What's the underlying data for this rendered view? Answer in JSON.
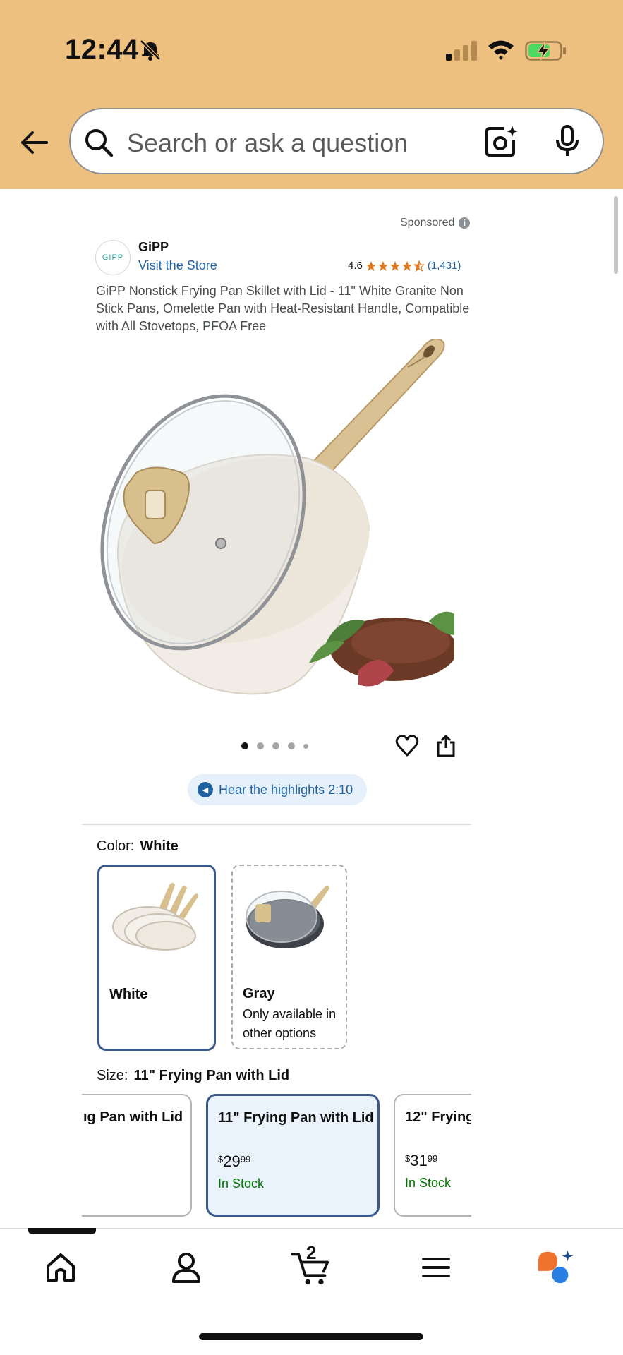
{
  "status_bar": {
    "time": "12:44",
    "icons": [
      "bell-slash-icon",
      "signal-icon",
      "wifi-icon",
      "battery-charging-icon"
    ]
  },
  "search": {
    "placeholder": "Search or ask a question",
    "icons": [
      "back-arrow-icon",
      "search-icon",
      "camera-sparkle-icon",
      "microphone-icon"
    ]
  },
  "product": {
    "sponsored_label": "Sponsored",
    "brand_logo_text": "GIPP",
    "brand_name": "GiPP",
    "visit_store": "Visit the Store",
    "rating_value": "4.6",
    "rating_stars": 4.5,
    "rating_count": "(1,431)",
    "title": "GiPP Nonstick Frying Pan Skillet with Lid - 11\" White Granite Non Stick Pans, Omelette Pan with Heat-Resistant Handle, Compatible with All Stovetops, PFOA Free",
    "image_dots": 5,
    "active_dot": 0,
    "hear_highlights": "Hear the highlights 2:10"
  },
  "color": {
    "label": "Color:",
    "selected": "White",
    "options": [
      {
        "name": "White",
        "note": ""
      },
      {
        "name": "Gray",
        "note": "Only available in other options"
      }
    ]
  },
  "size": {
    "label": "Size:",
    "selected": "11\" Frying Pan with Lid",
    "options": [
      {
        "title": "ıg Pan with Lid",
        "price_whole": "",
        "price_fraction": "",
        "stock": ""
      },
      {
        "title": "11\" Frying Pan with Lid",
        "price_symbol": "$",
        "price_whole": "29",
        "price_fraction": "99",
        "stock": "In Stock"
      },
      {
        "title": "12\" Frying",
        "price_symbol": "$",
        "price_whole": "31",
        "price_fraction": "99",
        "stock": "In Stock"
      }
    ]
  },
  "bottom_nav": {
    "items": [
      "home-icon",
      "account-icon",
      "cart-icon",
      "menu-icon",
      "rufus-icon"
    ],
    "cart_count": "2"
  },
  "colors": {
    "header_bg": "#eec07f",
    "link": "#2162a1",
    "selected_border": "#3a5b8a",
    "in_stock": "#007600",
    "star": "#de7921"
  }
}
